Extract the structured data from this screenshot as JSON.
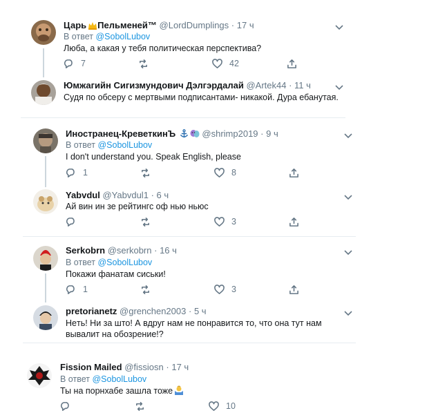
{
  "tweets": [
    {
      "name": "Царь",
      "name_suffix": "Пельменей™",
      "handle": "@LordDumplings",
      "dot": "·",
      "time": "17 ч",
      "reply_prefix": "В ответ",
      "reply_to": "@SobolLubov",
      "text": "Люба, а какая у тебя политическая перспектива?",
      "replies": "7",
      "retweets": "",
      "likes": "42",
      "emoji": "crown-icon"
    },
    {
      "name": "Юмжагийн Сигизмундович Дэлгэрдалай",
      "handle": "@Artek44",
      "dot": "·",
      "time": "11 ч",
      "text": "Судя по обсеру с мертвыми подписантами- никакой. Дура ебанутая."
    },
    {
      "name": "Иностранец-КреветкинЪ",
      "handle": "@shrimp2019",
      "dot": "·",
      "time": "9 ч",
      "reply_prefix": "В ответ",
      "reply_to": "@SobolLubov",
      "text": "I don't understand you. Speak English, please",
      "replies": "1",
      "retweets": "",
      "likes": "8",
      "emoji": "anchor-icon, theater-masks-icon"
    },
    {
      "name": "Yabvdul",
      "handle": "@Yabvdul1",
      "dot": "·",
      "time": "6 ч",
      "text": "Ай вин ин зе рейтингс оф нью ньюс",
      "replies": "",
      "retweets": "",
      "likes": "3"
    },
    {
      "name": "Serkobrn",
      "handle": "@serkobrn",
      "dot": "·",
      "time": "16 ч",
      "reply_prefix": "В ответ",
      "reply_to": "@SobolLubov",
      "text": "Покажи фанатам сиськи!",
      "replies": "1",
      "retweets": "",
      "likes": "3"
    },
    {
      "name": "pretorianetz",
      "handle": "@grenchen2003",
      "dot": "·",
      "time": "5 ч",
      "text": "Нeть! Ни за што! А вдруг нам не понравится то, что она тут нам вывалит на обозрение!?"
    },
    {
      "name": "Fission Mailed",
      "handle": "@fissiosn",
      "dot": "·",
      "time": "17 ч",
      "reply_prefix": "В ответ",
      "reply_to": "@SobolLubov",
      "text": "Ты на порнхабе зашла тоже",
      "replies": "",
      "retweets": "",
      "likes": "10",
      "emoji": "person-shrugging-icon"
    }
  ]
}
